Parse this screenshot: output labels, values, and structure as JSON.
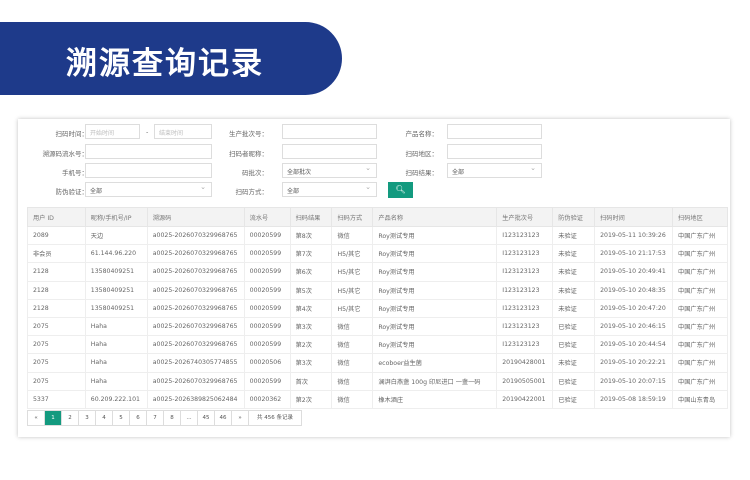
{
  "header": {
    "title": "溯源查询记录"
  },
  "filters": {
    "scan_time_label": "扫码时间：",
    "start_placeholder": "开始时间",
    "end_placeholder": "结束时间",
    "range_sep": "-",
    "batch_label": "生产批次号：",
    "product_label": "产品名称：",
    "trace_serial_label": "溯源码流水号：",
    "scanner_nick_label": "扫码者昵称：",
    "region_label": "扫码地区：",
    "phone_label": "手机号：",
    "code_batch_label": "码批次：",
    "code_batch_value": "全部批次",
    "result_label": "扫码结果：",
    "result_value": "全部",
    "verify_label": "防伪验证：",
    "verify_value": "全部",
    "method_label": "扫码方式：",
    "method_value": "全部",
    "search_icon": "search-icon"
  },
  "table": {
    "headers": [
      "用户 ID",
      "昵称/手机号/IP",
      "溯源码",
      "流水号",
      "扫码结果",
      "扫码方式",
      "产品名称",
      "生产批次号",
      "防伪验证",
      "扫码时间",
      "扫码地区"
    ],
    "rows": [
      [
        "2089",
        "天边",
        "a0025-2026070329968765",
        "00020599",
        "第8次",
        "微信",
        "Roy测试专用",
        "I123123123",
        "未验证",
        "2019-05-11 10:39:26",
        "中国广东广州"
      ],
      [
        "非会员",
        "61.144.96.220",
        "a0025-2026070329968765",
        "00020599",
        "第7次",
        "H5/其它",
        "Roy测试专用",
        "I123123123",
        "未验证",
        "2019-05-10 21:17:53",
        "中国广东广州"
      ],
      [
        "2128",
        "13580409251",
        "a0025-2026070329968765",
        "00020599",
        "第6次",
        "H5/其它",
        "Roy测试专用",
        "I123123123",
        "未验证",
        "2019-05-10 20:49:41",
        "中国广东广州"
      ],
      [
        "2128",
        "13580409251",
        "a0025-2026070329968765",
        "00020599",
        "第5次",
        "H5/其它",
        "Roy测试专用",
        "I123123123",
        "未验证",
        "2019-05-10 20:48:35",
        "中国广东广州"
      ],
      [
        "2128",
        "13580409251",
        "a0025-2026070329968765",
        "00020599",
        "第4次",
        "H5/其它",
        "Roy测试专用",
        "I123123123",
        "未验证",
        "2019-05-10 20:47:20",
        "中国广东广州"
      ],
      [
        "2075",
        "Haha",
        "a0025-2026070329968765",
        "00020599",
        "第3次",
        "微信",
        "Roy测试专用",
        "I123123123",
        "已验证",
        "2019-05-10 20:46:15",
        "中国广东广州"
      ],
      [
        "2075",
        "Haha",
        "a0025-2026070329968765",
        "00020599",
        "第2次",
        "微信",
        "Roy测试专用",
        "I123123123",
        "已验证",
        "2019-05-10 20:44:54",
        "中国广东广州"
      ],
      [
        "2075",
        "Haha",
        "a0025-2026740305774855",
        "00020506",
        "第3次",
        "微信",
        "ecoboer益生菌",
        "20190428001",
        "未验证",
        "2019-05-10 20:22:21",
        "中国广东广州"
      ],
      [
        "2075",
        "Haha",
        "a0025-2026070329968765",
        "00020599",
        "首次",
        "微信",
        "澜湃白燕盏 100g 印尼进口 一盏一码",
        "20190505001",
        "已验证",
        "2019-05-10 20:07:15",
        "中国广东广州"
      ],
      [
        "5337",
        "60.209.222.101",
        "a0025-2026389825062484",
        "00020362",
        "第2次",
        "微信",
        "橡木酒庄",
        "20190422001",
        "已验证",
        "2019-05-08 18:59:19",
        "中国山东青岛"
      ]
    ]
  },
  "pagination": {
    "prev": "«",
    "pages": [
      "1",
      "2",
      "3",
      "4",
      "5",
      "6",
      "7",
      "8",
      "...",
      "45",
      "46"
    ],
    "current": "1",
    "next": "»",
    "total": "共 456 条记录"
  },
  "colors": {
    "banner": "#1e3a8a",
    "accent": "#139a7f"
  }
}
